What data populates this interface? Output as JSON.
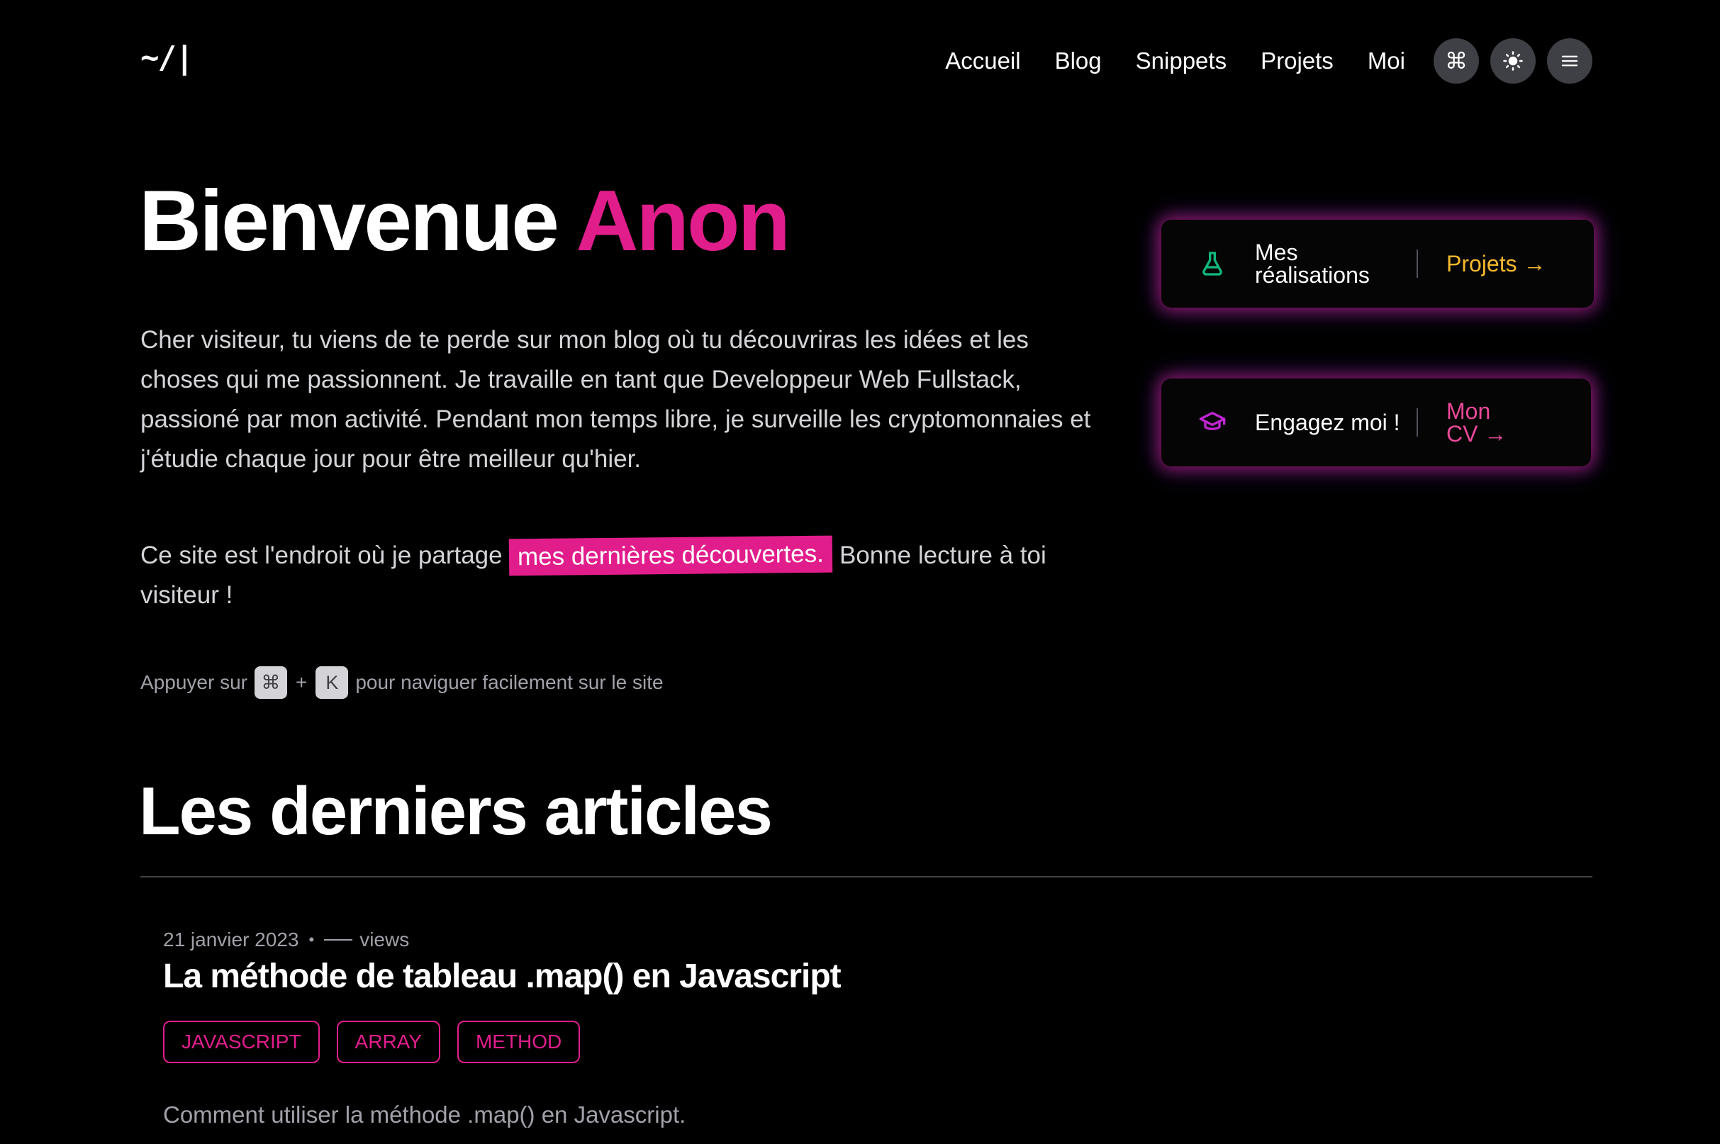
{
  "header": {
    "logo": "~/|",
    "nav": [
      "Accueil",
      "Blog",
      "Snippets",
      "Projets",
      "Moi"
    ],
    "icons": {
      "command": "command-icon",
      "theme": "sun-icon",
      "menu": "hamburger-menu-icon"
    }
  },
  "hero": {
    "title_main": "Bienvenue ",
    "title_accent": "Anon",
    "intro": "Cher visiteur, tu viens de te perde sur mon blog où tu découvriras les idées et les choses qui me passionnent. Je travaille en tant que Developpeur Web Fullstack, passioné par mon activité. Pendant mon temps libre, je surveille les cryptomonnaies et j'étudie chaque jour pour être meilleur qu'hier.",
    "intro2_before": "Ce site est l'endroit où je partage ",
    "intro2_highlight": "mes dernières découvertes.",
    "intro2_after": " Bonne lecture à toi visiteur !",
    "hint_before": "Appuyer sur",
    "hint_key1": "⌘",
    "hint_plus": "+",
    "hint_key2": "K",
    "hint_after": "pour naviguer facilement sur le site"
  },
  "cards": [
    {
      "icon": "flask-icon",
      "text": "Mes réalisations",
      "link": "Projets →"
    },
    {
      "icon": "graduation-cap-icon",
      "text": "Engagez moi !",
      "link": "Mon CV →"
    }
  ],
  "articles_section": {
    "title": "Les derniers articles",
    "items": [
      {
        "date": "21 janvier 2023",
        "separator": "•",
        "views": "views",
        "title": "La méthode de tableau .map() en Javascript",
        "tags": [
          "JAVASCRIPT",
          "ARRAY",
          "METHOD"
        ],
        "excerpt": "Comment utiliser la méthode .map() en Javascript."
      }
    ]
  },
  "colors": {
    "accent_pink": "#e11d8c",
    "projects_link": "#f5b82e",
    "flask_icon": "#10b981",
    "cap_icon": "#c026d3",
    "background": "#000000"
  }
}
